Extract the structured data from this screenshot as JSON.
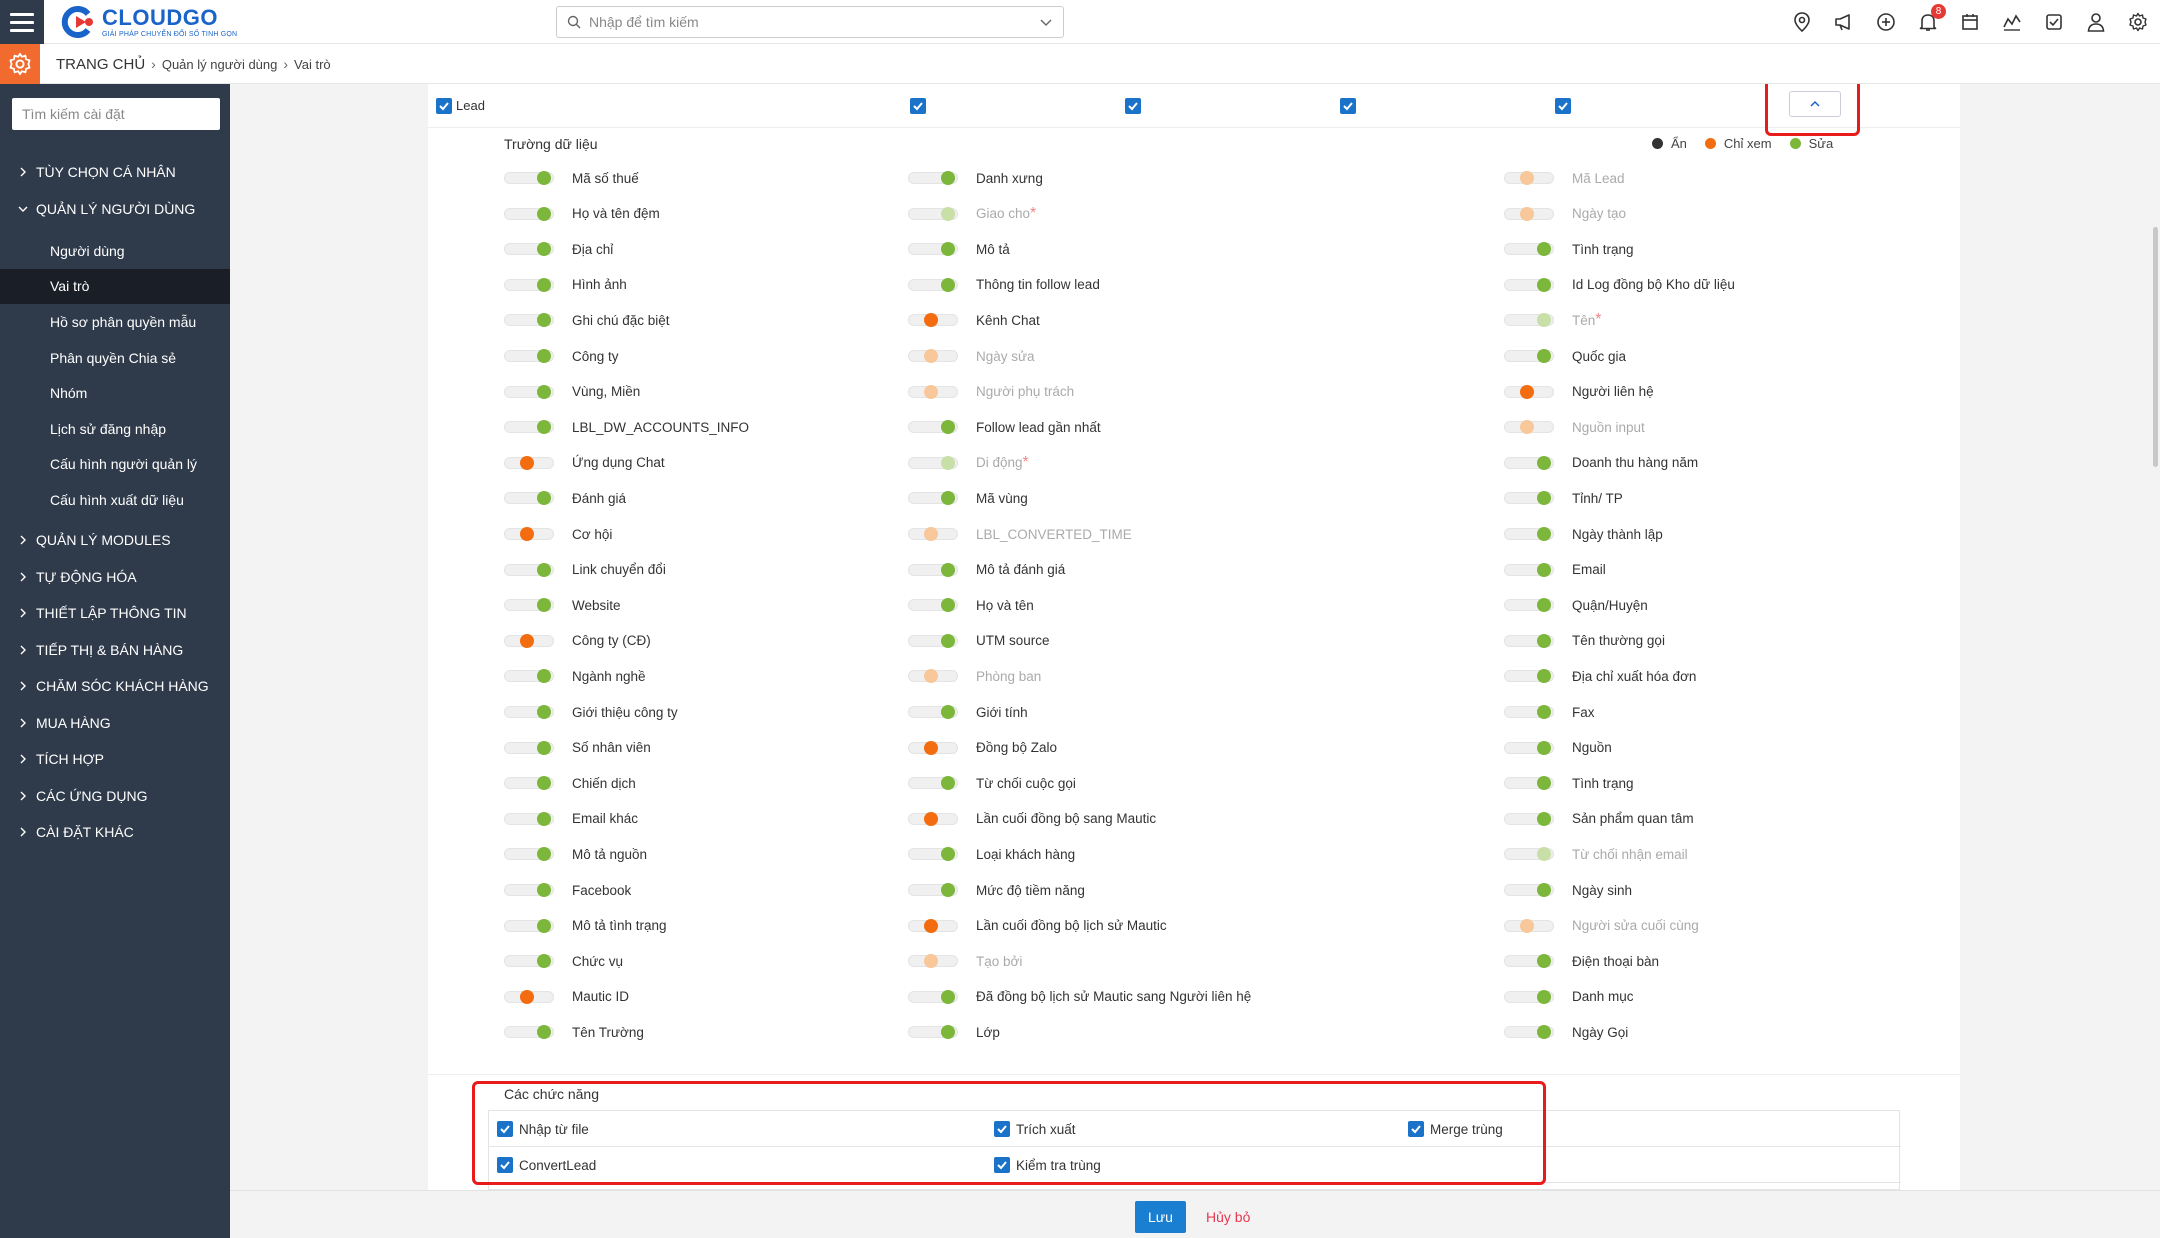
{
  "header": {
    "logo_name": "CLOUDGO",
    "logo_tagline": "GIẢI PHÁP CHUYỂN ĐỔI SỐ TINH GỌN",
    "search_placeholder": "Nhập để tìm kiếm",
    "notification_count": "8",
    "icons": [
      "location-icon",
      "megaphone-icon",
      "add-circle-icon",
      "bell-icon",
      "calendar-icon",
      "chart-icon",
      "task-check-icon",
      "user-icon",
      "settings-icon"
    ]
  },
  "breadcrumb": {
    "home": "TRANG CHỦ",
    "level1": "Quản lý người dùng",
    "level2": "Vai trò"
  },
  "sidebar": {
    "search_placeholder": "Tìm kiếm cài đặt",
    "groups_top": [
      {
        "label": "TÙY CHỌN CÁ NHÂN",
        "expanded": false
      },
      {
        "label": "QUẢN LÝ NGƯỜI DÙNG",
        "expanded": true
      }
    ],
    "sub_items": [
      {
        "label": "Người dùng",
        "active": false
      },
      {
        "label": "Vai trò",
        "active": true
      },
      {
        "label": "Hồ sơ phân quyền mẫu",
        "active": false
      },
      {
        "label": "Phân quyền Chia sẻ",
        "active": false
      },
      {
        "label": "Nhóm",
        "active": false
      },
      {
        "label": "Lịch sử đăng nhập",
        "active": false
      },
      {
        "label": "Cấu hình người quản lý",
        "active": false
      },
      {
        "label": "Cấu hình xuất dữ liệu",
        "active": false
      }
    ],
    "groups_bottom": [
      {
        "label": "QUẢN LÝ MODULES"
      },
      {
        "label": "TỰ ĐỘNG HÓA"
      },
      {
        "label": "THIẾT LẬP THÔNG TIN"
      },
      {
        "label": "TIẾP THỊ & BÁN HÀNG"
      },
      {
        "label": "CHĂM SÓC KHÁCH HÀNG"
      },
      {
        "label": "MUA HÀNG"
      },
      {
        "label": "TÍCH HỢP"
      },
      {
        "label": "CÁC ỨNG DỤNG"
      },
      {
        "label": "CÀI ĐẶT KHÁC"
      }
    ]
  },
  "module_row": {
    "label": "Lead",
    "checked": [
      true,
      true,
      true,
      true,
      true
    ]
  },
  "fields_section": {
    "title": "Trường dữ liệu",
    "legend": [
      {
        "label": "Ẩn",
        "color": "#333333"
      },
      {
        "label": "Chỉ xem",
        "color": "#f36c10"
      },
      {
        "label": "Sửa",
        "color": "#7cb63a"
      }
    ],
    "columns": [
      [
        {
          "label": "Mã số thuế",
          "state": "green",
          "disabled": false
        },
        {
          "label": "Họ và tên đệm",
          "state": "green",
          "disabled": false
        },
        {
          "label": "Địa chỉ",
          "state": "green",
          "disabled": false
        },
        {
          "label": "Hình ảnh",
          "state": "green",
          "disabled": false
        },
        {
          "label": "Ghi chú đặc biệt",
          "state": "green",
          "disabled": false
        },
        {
          "label": "Công ty",
          "state": "green",
          "disabled": false
        },
        {
          "label": "Vùng, Miền",
          "state": "green",
          "disabled": false
        },
        {
          "label": "LBL_DW_ACCOUNTS_INFO",
          "state": "green",
          "disabled": false
        },
        {
          "label": "Ứng dụng Chat",
          "state": "orange",
          "disabled": false
        },
        {
          "label": "Đánh giá",
          "state": "green",
          "disabled": false
        },
        {
          "label": "Cơ hội",
          "state": "orange",
          "disabled": false
        },
        {
          "label": "Link chuyển đổi",
          "state": "green",
          "disabled": false
        },
        {
          "label": "Website",
          "state": "green",
          "disabled": false
        },
        {
          "label": "Công ty (CĐ)",
          "state": "orange",
          "disabled": false
        },
        {
          "label": "Ngành nghề",
          "state": "green",
          "disabled": false
        },
        {
          "label": "Giới thiệu công ty",
          "state": "green",
          "disabled": false
        },
        {
          "label": "Số nhân viên",
          "state": "green",
          "disabled": false
        },
        {
          "label": "Chiến dịch",
          "state": "green",
          "disabled": false
        },
        {
          "label": "Email khác",
          "state": "green",
          "disabled": false
        },
        {
          "label": "Mô tả nguồn",
          "state": "green",
          "disabled": false
        },
        {
          "label": "Facebook",
          "state": "green",
          "disabled": false
        },
        {
          "label": "Mô tả tình trạng",
          "state": "green",
          "disabled": false
        },
        {
          "label": "Chức vụ",
          "state": "green",
          "disabled": false
        },
        {
          "label": "Mautic ID",
          "state": "orange",
          "disabled": false
        },
        {
          "label": "Tên Trường",
          "state": "green",
          "disabled": false
        }
      ],
      [
        {
          "label": "Danh xưng",
          "state": "green",
          "disabled": false
        },
        {
          "label": "Giao cho",
          "state": "green",
          "disabled": true,
          "required": true
        },
        {
          "label": "Mô tả",
          "state": "green",
          "disabled": false
        },
        {
          "label": "Thông tin follow lead",
          "state": "green",
          "disabled": false
        },
        {
          "label": "Kênh Chat",
          "state": "orange",
          "disabled": false
        },
        {
          "label": "Ngày sửa",
          "state": "orange",
          "disabled": true
        },
        {
          "label": "Người phụ trách",
          "state": "orange",
          "disabled": true
        },
        {
          "label": "Follow lead gần nhất",
          "state": "green",
          "disabled": false
        },
        {
          "label": "Di động",
          "state": "green",
          "disabled": true,
          "required": true
        },
        {
          "label": "Mã vùng",
          "state": "green",
          "disabled": false
        },
        {
          "label": "LBL_CONVERTED_TIME",
          "state": "orange",
          "disabled": true
        },
        {
          "label": "Mô tả đánh giá",
          "state": "green",
          "disabled": false
        },
        {
          "label": "Họ và tên",
          "state": "green",
          "disabled": false
        },
        {
          "label": "UTM source",
          "state": "green",
          "disabled": false
        },
        {
          "label": "Phòng ban",
          "state": "orange",
          "disabled": true
        },
        {
          "label": "Giới tính",
          "state": "green",
          "disabled": false
        },
        {
          "label": "Đồng bộ Zalo",
          "state": "orange",
          "disabled": false
        },
        {
          "label": "Từ chối cuộc gọi",
          "state": "green",
          "disabled": false
        },
        {
          "label": "Lần cuối đồng bộ sang Mautic",
          "state": "orange",
          "disabled": false
        },
        {
          "label": "Loại khách hàng",
          "state": "green",
          "disabled": false
        },
        {
          "label": "Mức độ tiềm năng",
          "state": "green",
          "disabled": false
        },
        {
          "label": "Lần cuối đồng bộ lịch sử Mautic",
          "state": "orange",
          "disabled": false
        },
        {
          "label": "Tạo bởi",
          "state": "orange",
          "disabled": true
        },
        {
          "label": "Đã đồng bộ lịch sử Mautic sang Người liên hệ",
          "state": "green",
          "disabled": false
        },
        {
          "label": "Lớp",
          "state": "green",
          "disabled": false
        }
      ],
      [
        {
          "label": "Mã Lead",
          "state": "orange",
          "disabled": true
        },
        {
          "label": "Ngày tạo",
          "state": "orange",
          "disabled": true
        },
        {
          "label": "Tình trạng",
          "state": "green",
          "disabled": false
        },
        {
          "label": "Id Log đồng bộ Kho dữ liệu",
          "state": "green",
          "disabled": false
        },
        {
          "label": "Tên",
          "state": "green",
          "disabled": true,
          "required": true
        },
        {
          "label": "Quốc gia",
          "state": "green",
          "disabled": false
        },
        {
          "label": "Người liên hệ",
          "state": "orange",
          "disabled": false
        },
        {
          "label": "Nguồn input",
          "state": "orange",
          "disabled": true
        },
        {
          "label": "Doanh thu hàng năm",
          "state": "green",
          "disabled": false
        },
        {
          "label": "Tỉnh/ TP",
          "state": "green",
          "disabled": false
        },
        {
          "label": "Ngày thành lập",
          "state": "green",
          "disabled": false
        },
        {
          "label": "Email",
          "state": "green",
          "disabled": false
        },
        {
          "label": "Quận/Huyện",
          "state": "green",
          "disabled": false
        },
        {
          "label": "Tên thường gọi",
          "state": "green",
          "disabled": false
        },
        {
          "label": "Địa chỉ xuất hóa đơn",
          "state": "green",
          "disabled": false
        },
        {
          "label": "Fax",
          "state": "green",
          "disabled": false
        },
        {
          "label": "Nguồn",
          "state": "green",
          "disabled": false
        },
        {
          "label": "Tình trạng",
          "state": "green",
          "disabled": false
        },
        {
          "label": "Sản phẩm quan tâm",
          "state": "green",
          "disabled": false
        },
        {
          "label": "Từ chối nhận email",
          "state": "green",
          "disabled": true
        },
        {
          "label": "Ngày sinh",
          "state": "green",
          "disabled": false
        },
        {
          "label": "Người sửa cuối cùng",
          "state": "orange",
          "disabled": true
        },
        {
          "label": "Điện thoại bàn",
          "state": "green",
          "disabled": false
        },
        {
          "label": "Danh mục",
          "state": "green",
          "disabled": false
        },
        {
          "label": "Ngày Gọi",
          "state": "green",
          "disabled": false
        }
      ]
    ]
  },
  "functions_section": {
    "title": "Các chức năng",
    "items": [
      {
        "label": "Nhập từ file",
        "checked": true
      },
      {
        "label": "Trích xuất",
        "checked": true
      },
      {
        "label": "Merge trùng",
        "checked": true
      },
      {
        "label": "ConvertLead",
        "checked": true
      },
      {
        "label": "Kiểm tra trùng",
        "checked": true
      }
    ]
  },
  "footer": {
    "save_label": "Lưu",
    "cancel_label": "Hủy bỏ"
  }
}
